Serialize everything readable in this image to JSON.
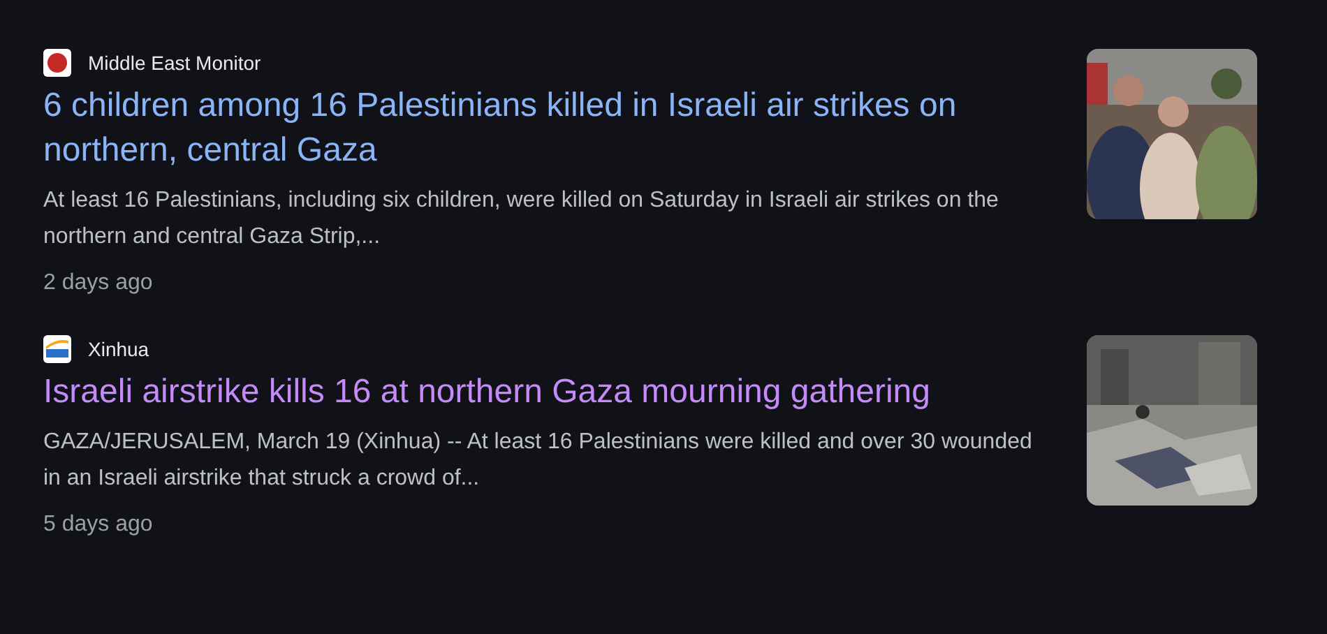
{
  "results": [
    {
      "source": "Middle East Monitor",
      "title": "6 children among 16 Palestinians killed in Israeli air strikes on northern, central Gaza",
      "visited": false,
      "snippet": "At least 16 Palestinians, including six children, were killed on Saturday in Israeli air strikes on the northern and central Gaza Strip,...",
      "time": "2 days ago"
    },
    {
      "source": "Xinhua",
      "title": "Israeli airstrike kills 16 at northern Gaza mourning gathering",
      "visited": true,
      "snippet": "GAZA/JERUSALEM, March 19 (Xinhua) -- At least 16 Palestinians were killed and over 30 wounded in an Israeli airstrike that struck a crowd of...",
      "time": "5 days ago"
    }
  ]
}
